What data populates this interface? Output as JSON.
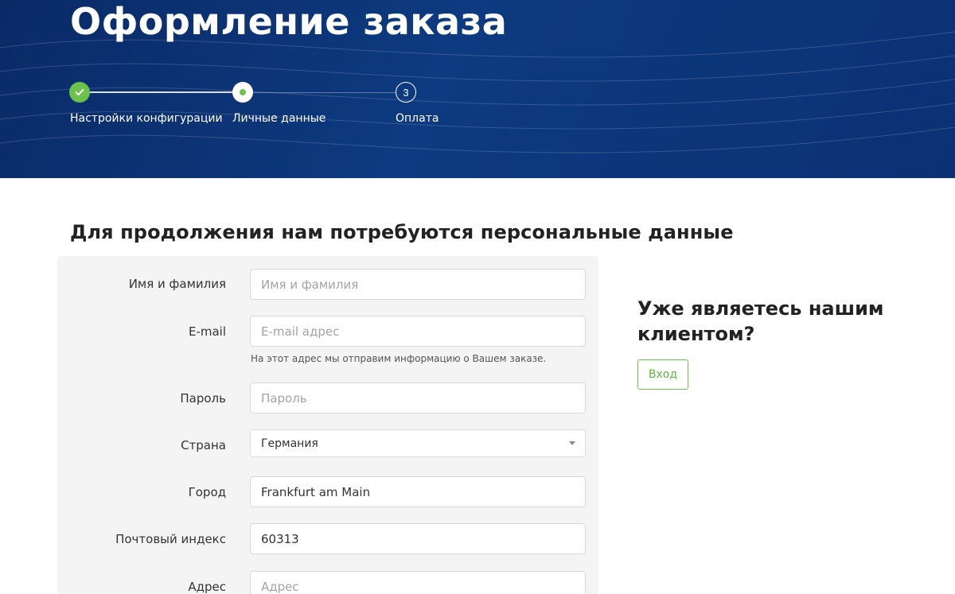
{
  "header": {
    "title": "Оформление заказа"
  },
  "stepper": {
    "steps": [
      {
        "label": "Настройки конфигурации",
        "state": "done",
        "icon": "check-icon"
      },
      {
        "label": "Личные данные",
        "state": "current",
        "icon": "dot-icon"
      },
      {
        "label": "Оплата",
        "state": "todo",
        "number": "3"
      }
    ]
  },
  "form": {
    "heading": "Для продолжения нам потребуются персональные данные",
    "name": {
      "label": "Имя и фамилия",
      "placeholder": "Имя и фамилия",
      "value": ""
    },
    "email": {
      "label": "E-mail",
      "placeholder": "E-mail адрес",
      "value": "",
      "hint": "На этот адрес мы отправим информацию о Вашем заказе."
    },
    "password": {
      "label": "Пароль",
      "placeholder": "Пароль",
      "value": ""
    },
    "country": {
      "label": "Страна",
      "value": "Германия"
    },
    "city": {
      "label": "Город",
      "value": "Frankfurt am Main"
    },
    "zip": {
      "label": "Почтовый индекс",
      "value": "60313"
    },
    "address": {
      "label": "Адрес",
      "placeholder": "Адрес",
      "value": ""
    }
  },
  "client": {
    "title": "Уже являетесь нашим клиентом?",
    "login_label": "Вход"
  },
  "colors": {
    "hero_bg": "#0d3a80",
    "accent_green": "#6cc24a",
    "panel_bg": "#f4f4f4"
  }
}
